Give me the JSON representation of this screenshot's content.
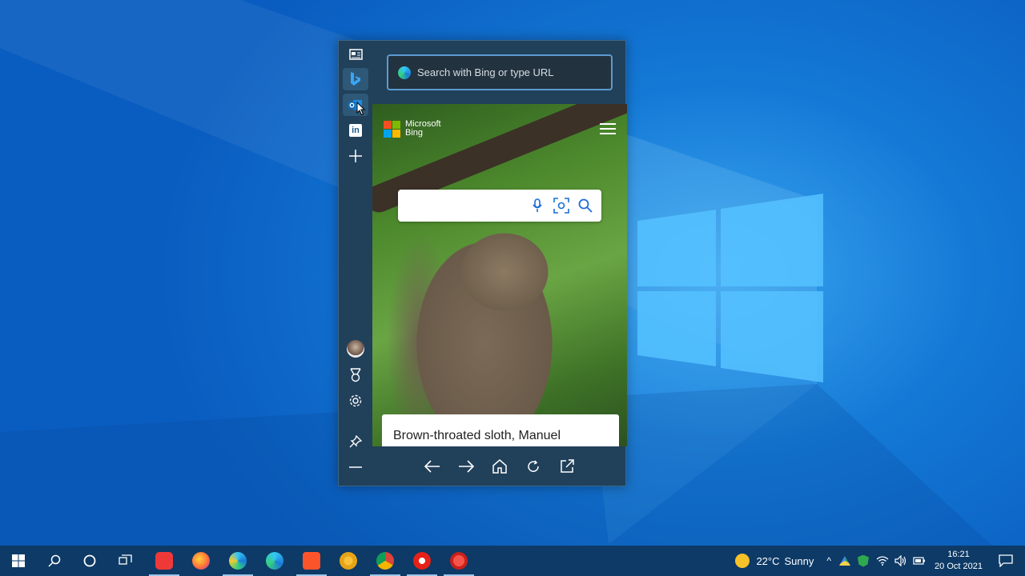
{
  "sidebar": {
    "address_placeholder": "Search with Bing or type URL",
    "rail": [
      {
        "name": "news-icon"
      },
      {
        "name": "bing-icon"
      },
      {
        "name": "outlook-icon"
      },
      {
        "name": "linkedin-icon",
        "label": "in"
      },
      {
        "name": "add-icon"
      }
    ],
    "bottom_rail": [
      "avatar",
      "rewards-icon",
      "settings-icon",
      "pin-icon",
      "minimize-icon"
    ]
  },
  "bing": {
    "logo_line1": "Microsoft",
    "logo_line2": "Bing",
    "caption": "Brown-throated sloth, Manuel"
  },
  "taskbar": {
    "weather_temp": "22°C",
    "weather_desc": "Sunny",
    "time": "16:21",
    "date": "20 Oct 2021"
  },
  "colors": {
    "taskbar": "#0d3a66",
    "panel": "#21405a",
    "accent": "#5b9bd0"
  }
}
